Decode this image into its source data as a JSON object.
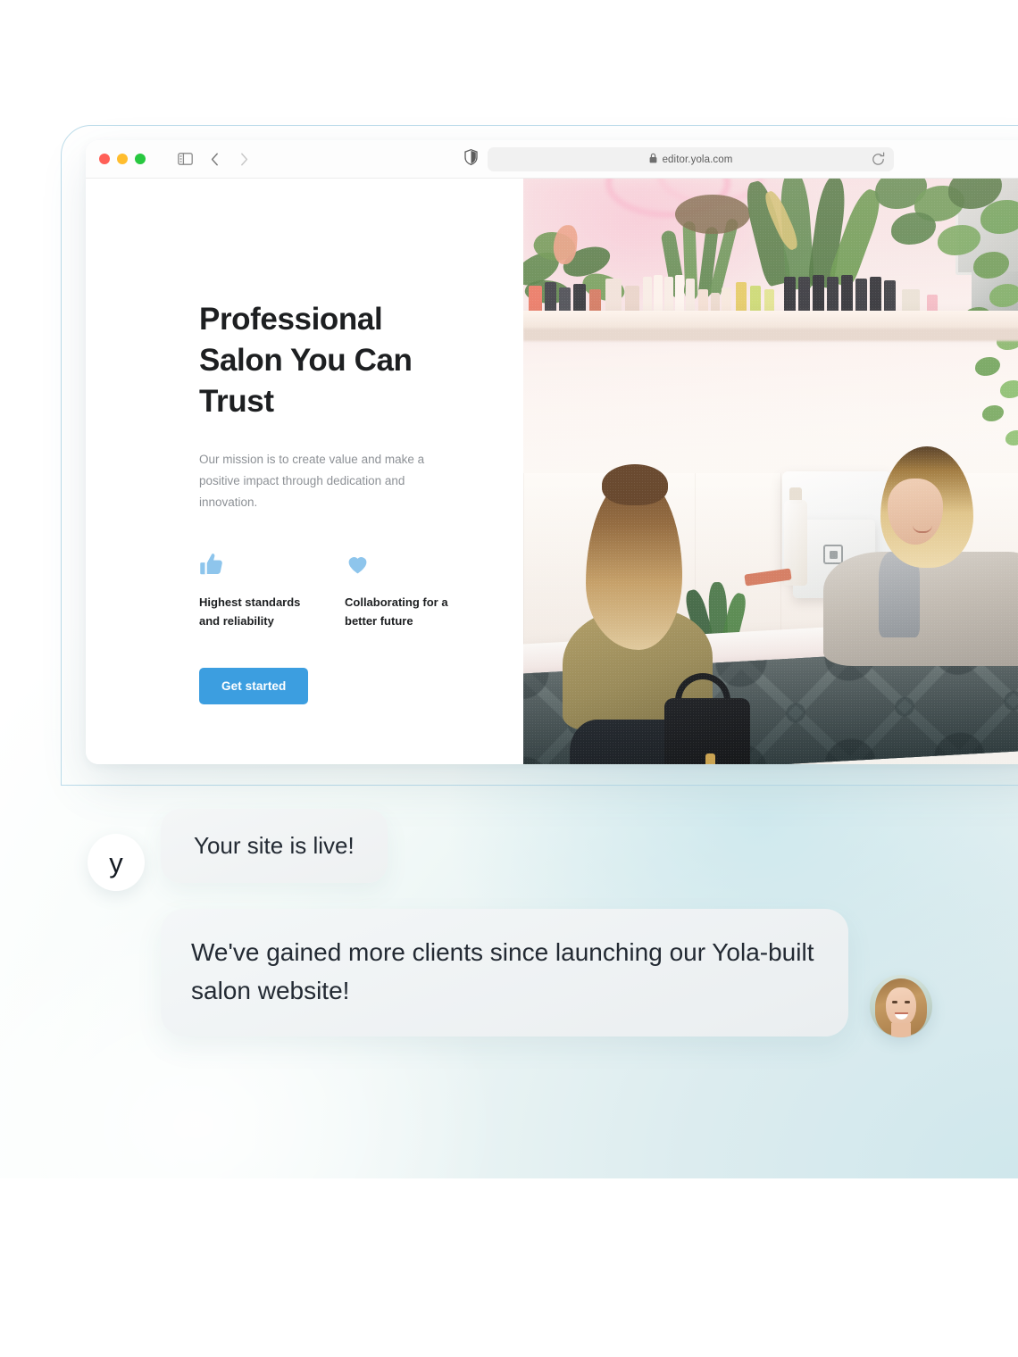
{
  "browser": {
    "traffic_lights": [
      {
        "name": "close",
        "color": "#ff5f57"
      },
      {
        "name": "minimize",
        "color": "#ffbd2e"
      },
      {
        "name": "maximize",
        "color": "#28c840"
      }
    ],
    "toolbar": {
      "sidebar_icon": "sidebar-toggle-icon",
      "back_icon": "chevron-left-icon",
      "forward_icon": "chevron-right-icon",
      "shield_icon": "privacy-shield-icon",
      "reload_icon": "reload-icon"
    },
    "address_bar": {
      "lock_icon": "lock-icon",
      "url": "editor.yola.com",
      "placeholder": "Search or enter website name"
    }
  },
  "site": {
    "hero": {
      "title": "Professional Salon You Can Trust",
      "subtitle": "Our mission is to create value and make a positive impact through dedication and innovation.",
      "cta_label": "Get started",
      "cta_color": "#3c9ee0",
      "features": [
        {
          "icon": "thumbs-up-icon",
          "label": "Highest standards and reliability",
          "icon_color": "#8ec5ec"
        },
        {
          "icon": "heart-icon",
          "label": "Collaborating for a better future",
          "icon_color": "#8ec5ec"
        }
      ]
    },
    "hero_image": {
      "alt": "Two women at a salon reception counter with plants and product bottles on a shelf"
    }
  },
  "chat": {
    "brand_avatar_letter": "y",
    "messages": [
      {
        "from": "yola",
        "text": "Your site is live!"
      },
      {
        "from": "client",
        "text": "We've gained more clients since launching our Yola-built salon website!"
      }
    ],
    "client_avatar_alt": "Smiling woman portrait"
  },
  "theme": {
    "accent": "#3c9ee0",
    "icon_accent": "#8ec5ec",
    "bubble_bg": "#f1f4f5",
    "frame_border": "#bcdcea",
    "text_dark": "#1d1f21",
    "text_muted": "#8d9196"
  }
}
